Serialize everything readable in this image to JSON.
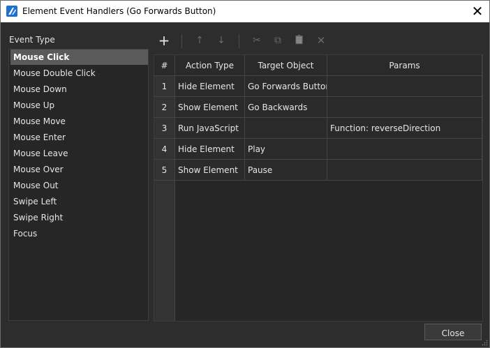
{
  "window": {
    "title": "Element Event Handlers (Go Forwards Button)"
  },
  "event_type": {
    "label": "Event Type",
    "items": [
      "Mouse Click",
      "Mouse Double Click",
      "Mouse Down",
      "Mouse Up",
      "Mouse Move",
      "Mouse Enter",
      "Mouse Leave",
      "Mouse Over",
      "Mouse Out",
      "Swipe Left",
      "Swipe Right",
      "Focus"
    ],
    "selected": "Mouse Click"
  },
  "toolbar": {
    "add": "+",
    "move_up": "↑",
    "move_down": "↓",
    "cut": "✂",
    "copy": "⧉",
    "paste": "📋",
    "delete": "✕"
  },
  "table": {
    "headers": [
      "#",
      "Action Type",
      "Target Object",
      "Params"
    ],
    "rows": [
      [
        "1",
        "Hide Element",
        "Go Forwards Button",
        ""
      ],
      [
        "2",
        "Show Element",
        "Go Backwards",
        ""
      ],
      [
        "3",
        "Run JavaScript",
        "",
        "Function: reverseDirection"
      ],
      [
        "4",
        "Hide Element",
        "Play",
        ""
      ],
      [
        "5",
        "Show Element",
        "Pause",
        ""
      ]
    ]
  },
  "footer": {
    "close_label": "Close"
  },
  "colors": {
    "accent": "#1f6fd0",
    "background": "#2d2d2d",
    "selection": "#5a5a5a"
  }
}
